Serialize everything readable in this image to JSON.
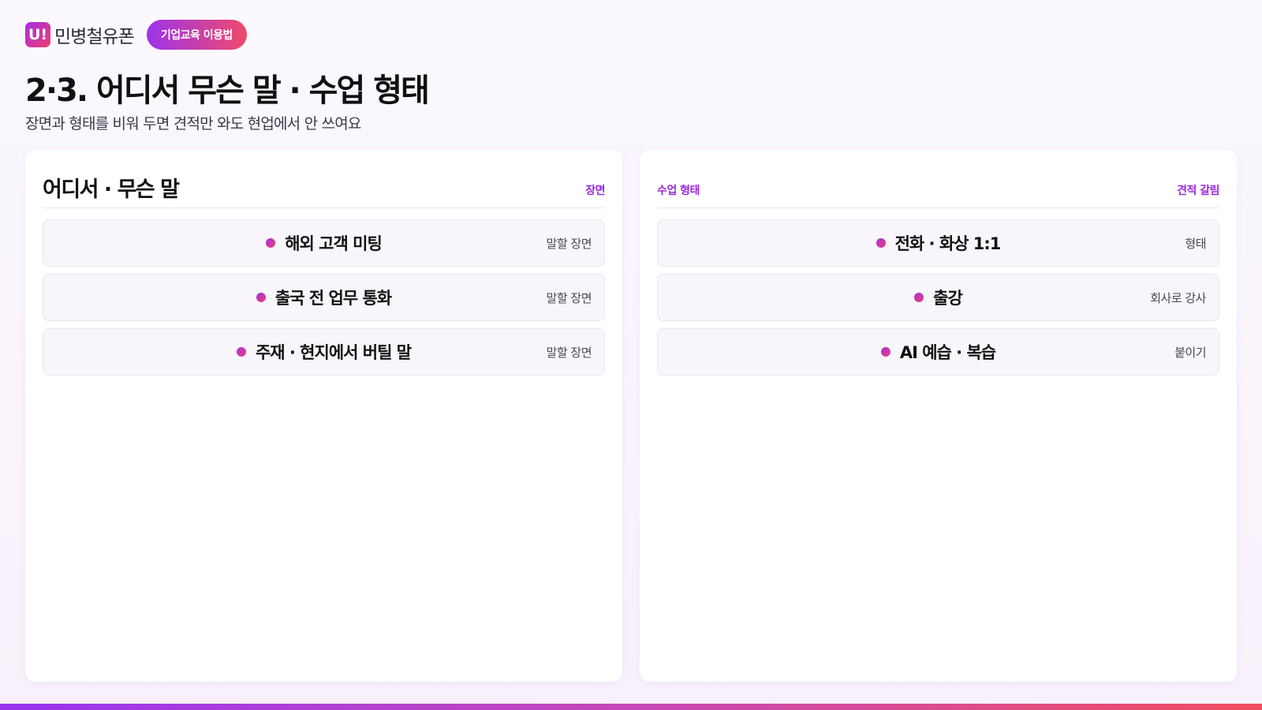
{
  "header": {
    "logo_mark": "U!",
    "logo_text": "민병철유폰",
    "pill_label": "기업교육 이용법"
  },
  "page": {
    "title": "2·3. 어디서 무슨 말 · 수업 형태",
    "subtitle": "장면과 형태를 비워 두면 견적만 와도 현업에서 안 쓰여요"
  },
  "left_panel": {
    "title": "어디서 · 무슨 말",
    "right_label": "장면",
    "rows": [
      {
        "label": "해외 고객 미팅",
        "tag": "말할 장면"
      },
      {
        "label": "출국 전 업무 통화",
        "tag": "말할 장면"
      },
      {
        "label": "주재 · 현지에서 버틸 말",
        "tag": "말할 장면"
      }
    ]
  },
  "right_panel": {
    "left_label": "수업 형태",
    "right_label": "견적 갈림",
    "rows": [
      {
        "label": "전화 · 화상 1:1",
        "tag": "형태"
      },
      {
        "label": "출강",
        "tag": "회사로 강사"
      },
      {
        "label": "AI 예습 · 복습",
        "tag": "붙이기"
      }
    ]
  },
  "colors": {
    "accent_purple": "#9b2bd9",
    "accent_pink": "#ef3d6e",
    "background": "#fbf8fe"
  }
}
